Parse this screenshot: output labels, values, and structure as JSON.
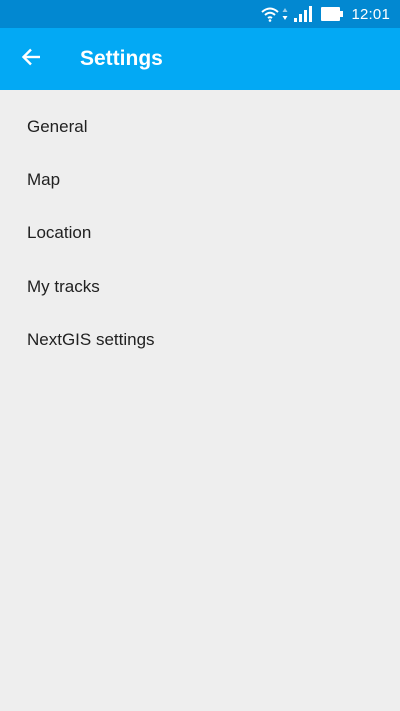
{
  "status_bar": {
    "time": "12:01",
    "background": "#0288d1",
    "icons": [
      "wifi-icon",
      "data-arrows-icon",
      "signal-icon",
      "battery-icon"
    ]
  },
  "toolbar": {
    "title": "Settings",
    "background": "#03a9f4",
    "back_icon": "arrow-left-icon"
  },
  "settings": {
    "items": [
      {
        "label": "General"
      },
      {
        "label": "Map"
      },
      {
        "label": "Location"
      },
      {
        "label": "My tracks"
      },
      {
        "label": "NextGIS settings"
      }
    ]
  },
  "colors": {
    "background": "#eeeeee",
    "text": "#212121"
  }
}
